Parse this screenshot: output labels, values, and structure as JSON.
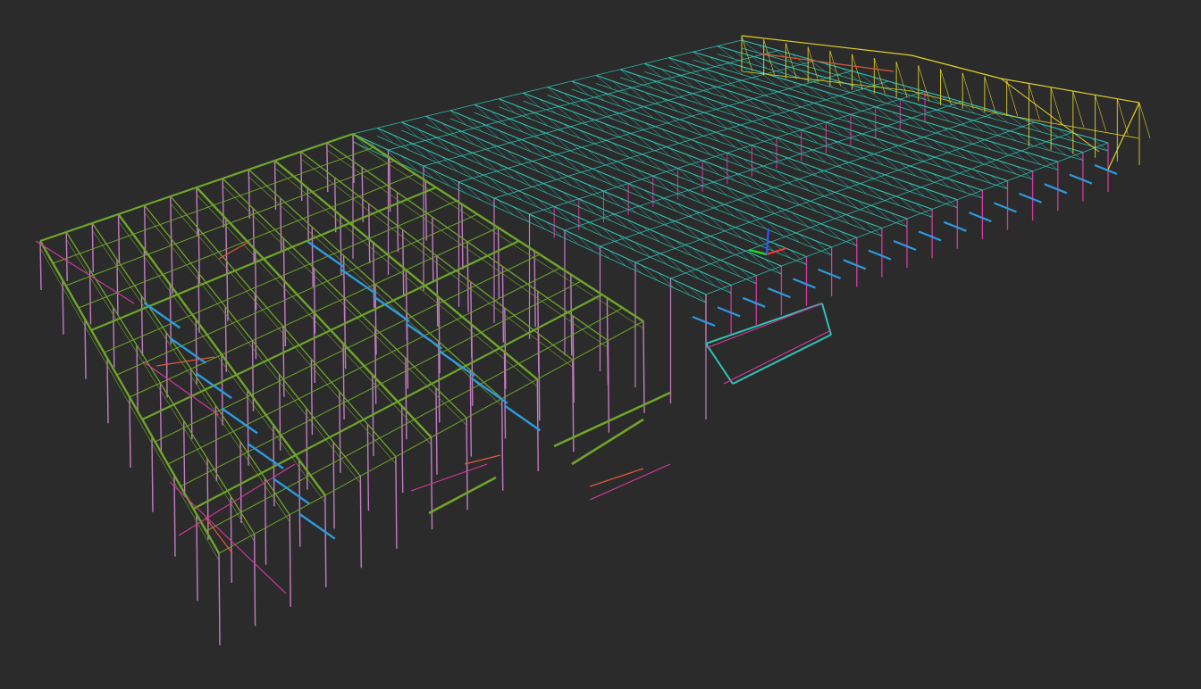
{
  "viewport": {
    "background": "#2b2b2b",
    "content": "3d-steel-frame-wireframe",
    "layers": [
      {
        "name": "main-roof-trusses",
        "color": "#2ec4b6"
      },
      {
        "name": "annex-roof-trusses",
        "color": "#6fa52a"
      },
      {
        "name": "end-frames",
        "color": "#e2d12a"
      },
      {
        "name": "columns",
        "color": "#c47bc4"
      },
      {
        "name": "bracing",
        "color": "#d63aa0"
      },
      {
        "name": "beams",
        "color": "#2d9be0"
      },
      {
        "name": "secondary-members",
        "color": "#e05a3a"
      }
    ]
  },
  "gizmo": {
    "axes": [
      {
        "name": "x",
        "color": "#ff3333"
      },
      {
        "name": "y",
        "color": "#22dd22"
      },
      {
        "name": "z",
        "color": "#3355ff"
      }
    ]
  }
}
